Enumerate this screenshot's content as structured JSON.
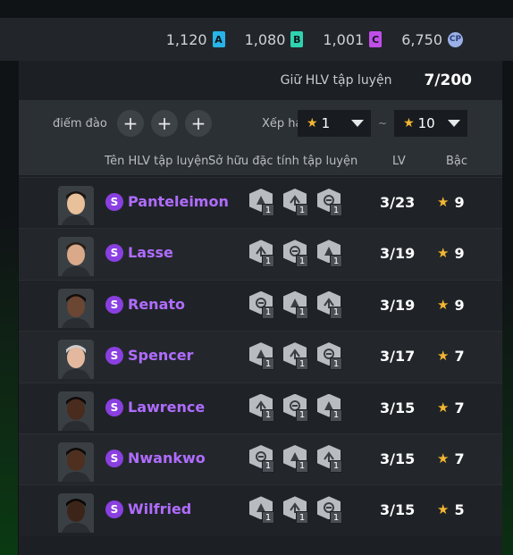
{
  "currencies": [
    {
      "value": "1,120",
      "icon": "A",
      "color": "#27b4e8"
    },
    {
      "value": "1,080",
      "icon": "B",
      "color": "#2fd3b0"
    },
    {
      "value": "1,001",
      "icon": "C",
      "color": "#c04ee8"
    },
    {
      "value": "6,750",
      "icon": "CP",
      "color": "#9ab0e6"
    }
  ],
  "holder": {
    "label": "Giữ HLV tập luyện",
    "value": "7/200"
  },
  "filters": {
    "points_label": "điểm đào t",
    "plus": "+",
    "rank_label": "Xếp hạ",
    "from": "1",
    "to": "10",
    "separator": "~"
  },
  "columns": {
    "name": "Tên HLV tập luyện",
    "owned": "Sở hữu đặc tính tập luyện",
    "lv": "LV",
    "rank": "Bậc"
  },
  "grade_letter": "S",
  "star": "★",
  "coaches": [
    {
      "name": "Panteleimon",
      "lv": "3/23",
      "rank": "9",
      "skin": "#e8c09a",
      "hair": "#1b1410",
      "traits": [
        "1",
        "1",
        "1"
      ]
    },
    {
      "name": "Lasse",
      "lv": "3/19",
      "rank": "9",
      "skin": "#d9a98a",
      "hair": "#2a1f18",
      "traits": [
        "1",
        "1",
        "1"
      ]
    },
    {
      "name": "Renato",
      "lv": "3/19",
      "rank": "9",
      "skin": "#6b4632",
      "hair": "#140e0a",
      "traits": [
        "1",
        "1",
        "1"
      ]
    },
    {
      "name": "Spencer",
      "lv": "3/17",
      "rank": "7",
      "skin": "#e3b89e",
      "hair": "#cfcfcf",
      "traits": [
        "1",
        "1",
        "1"
      ]
    },
    {
      "name": "Lawrence",
      "lv": "3/15",
      "rank": "7",
      "skin": "#4a2c1e",
      "hair": "#0e0a08",
      "traits": [
        "1",
        "1",
        "1"
      ]
    },
    {
      "name": "Nwankwo",
      "lv": "3/15",
      "rank": "7",
      "skin": "#4e2f20",
      "hair": "#0e0a08",
      "traits": [
        "1",
        "1",
        "1"
      ]
    },
    {
      "name": "Wilfried",
      "lv": "3/15",
      "rank": "5",
      "skin": "#3d2418",
      "hair": "#0a0806",
      "traits": [
        "1",
        "1",
        "1"
      ]
    }
  ]
}
